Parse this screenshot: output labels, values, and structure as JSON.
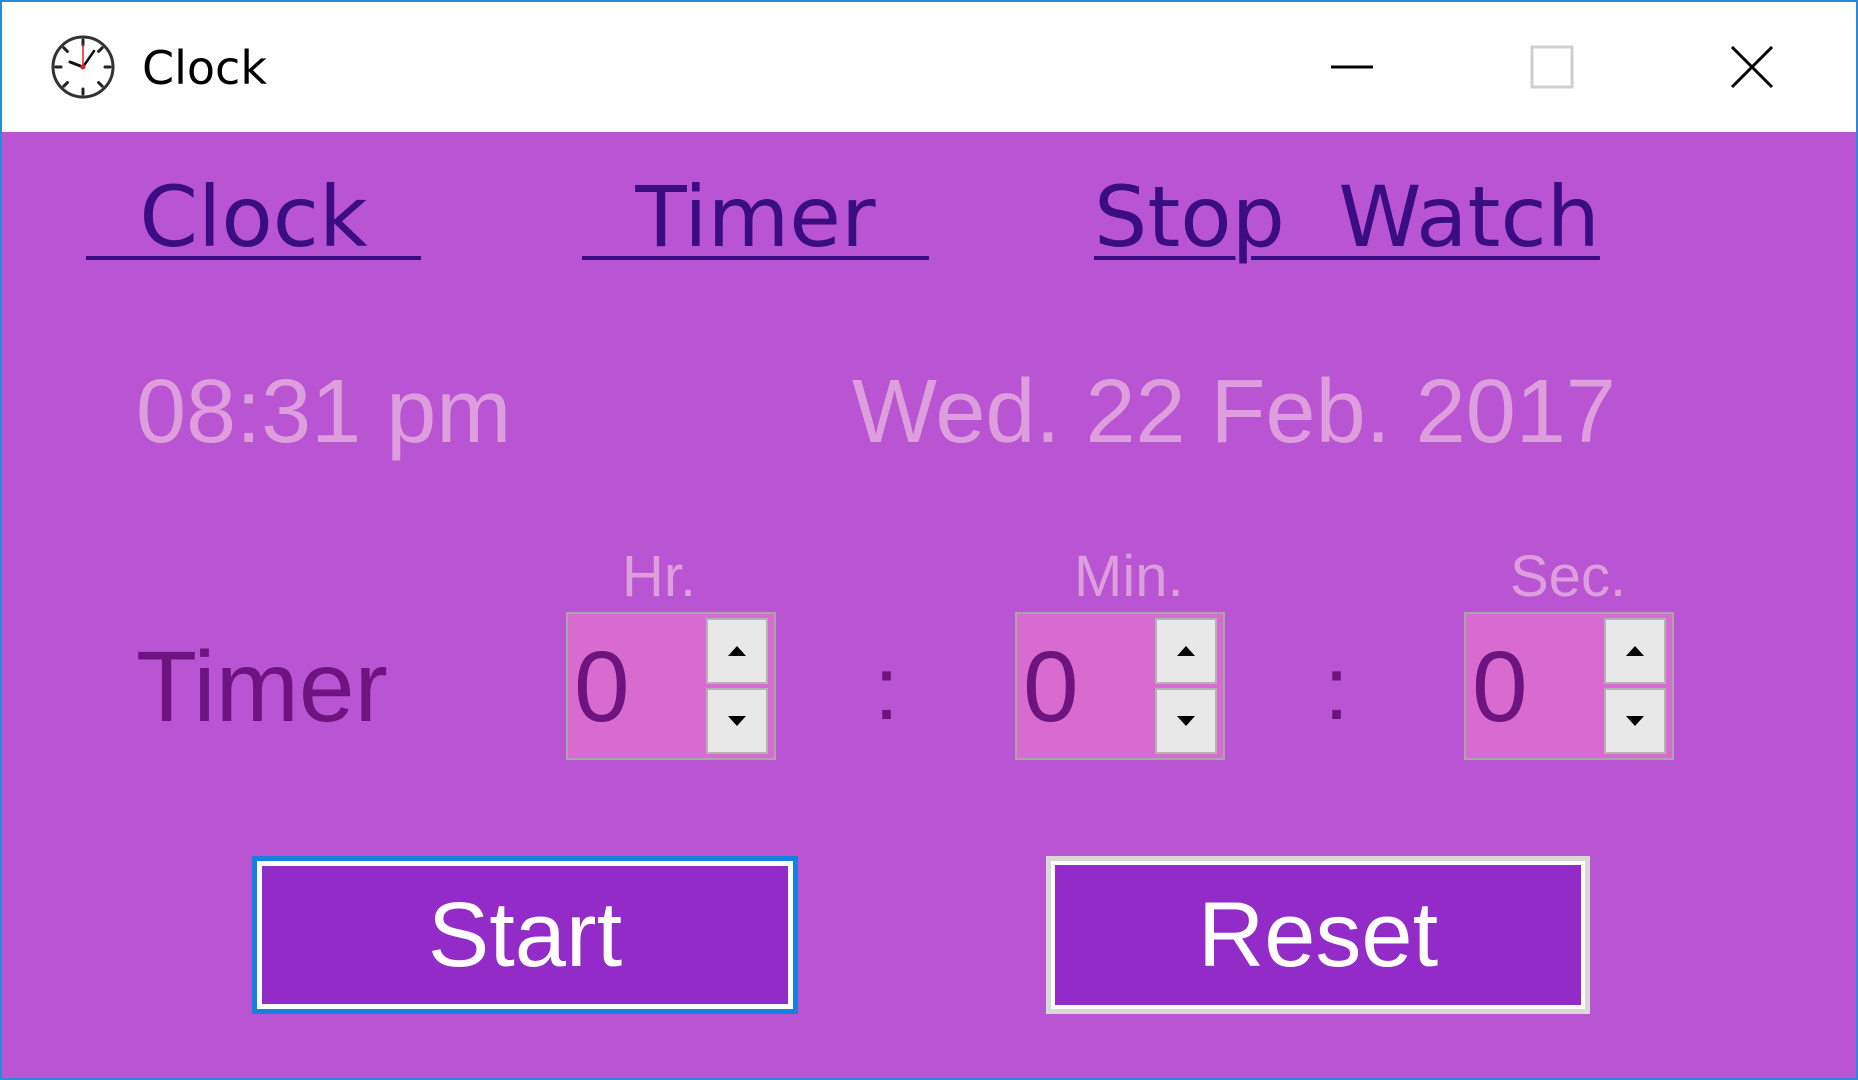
{
  "window": {
    "title": "Clock",
    "icon": "clock-icon",
    "controls": [
      "minimize-icon",
      "maximize-icon",
      "close-icon"
    ]
  },
  "nav": {
    "clock": "  Clock  ",
    "timer": "  Timer  ",
    "stopwatch": "Stop  Watch"
  },
  "display": {
    "time": "08:31 pm",
    "date": "Wed. 22 Feb. 2017"
  },
  "timer": {
    "label": "Timer",
    "units": {
      "hr": "Hr.",
      "min": "Min.",
      "sec": "Sec."
    },
    "values": {
      "hr": "0",
      "min": "0",
      "sec": "0"
    },
    "separator": ":"
  },
  "buttons": {
    "start": "Start",
    "reset": "Reset"
  },
  "colors": {
    "background": "#b954d2",
    "link": "#3a0d82",
    "faded_text": "#de9ede",
    "timer_text": "#6e137f",
    "button": "#922bc8",
    "spin_field": "#d86bd0",
    "focus_border": "#1481de"
  }
}
